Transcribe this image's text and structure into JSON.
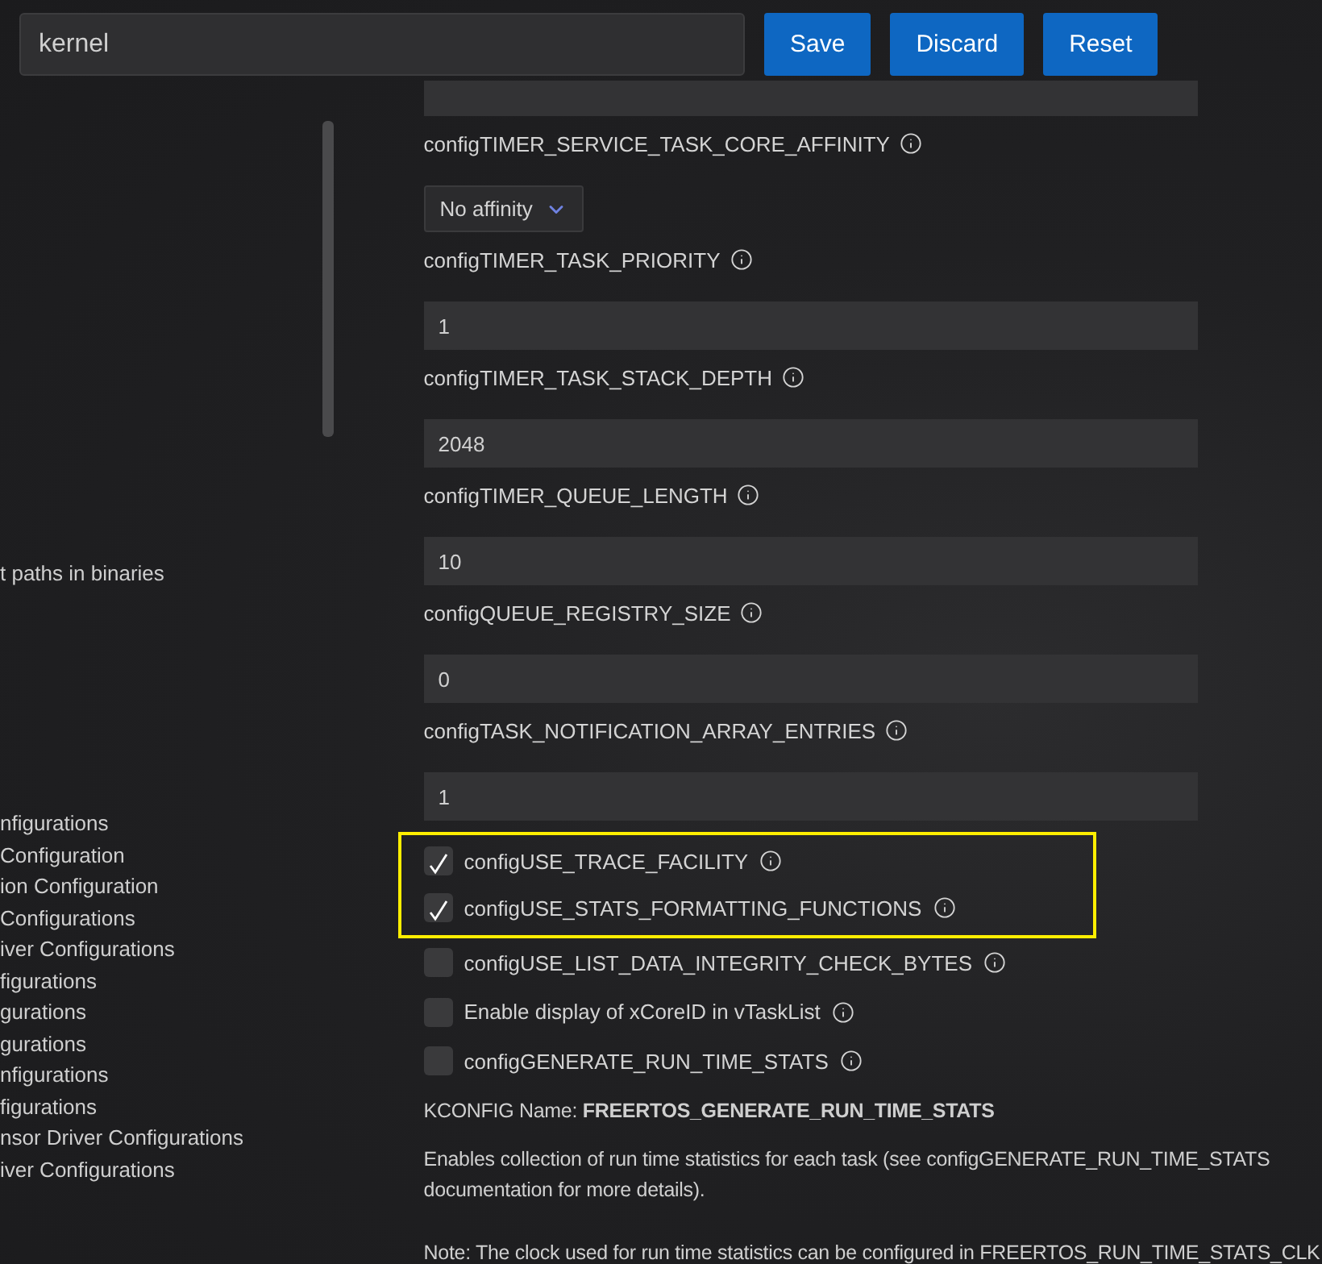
{
  "search": {
    "value": "kernel"
  },
  "buttons": [
    "Save",
    "Discard",
    "Reset"
  ],
  "sidebar": {
    "paths_item": "t paths in binaries",
    "items": [
      {
        "label": "nfigurations"
      },
      {
        "label": "Configuration"
      },
      {
        "label": "ion Configuration"
      },
      {
        "label": "Configurations"
      },
      {
        "label": "iver Configurations"
      },
      {
        "label": "figurations"
      },
      {
        "label": "gurations"
      },
      {
        "label": "gurations"
      },
      {
        "label": "nfigurations"
      },
      {
        "label": "figurations"
      },
      {
        "label": "nsor Driver Configurations"
      },
      {
        "label": "iver Configurations"
      }
    ]
  },
  "settings": [
    {
      "kind": "cut-field"
    },
    {
      "kind": "label",
      "label": "configTIMER_SERVICE_TASK_CORE_AFFINITY"
    },
    {
      "kind": "select",
      "value": "No affinity"
    },
    {
      "kind": "label",
      "label": "configTIMER_TASK_PRIORITY"
    },
    {
      "kind": "field",
      "value": "1"
    },
    {
      "kind": "label",
      "label": "configTIMER_TASK_STACK_DEPTH"
    },
    {
      "kind": "field",
      "value": "2048"
    },
    {
      "kind": "label",
      "label": "configTIMER_QUEUE_LENGTH"
    },
    {
      "kind": "field",
      "value": "10"
    },
    {
      "kind": "label",
      "label": "configQUEUE_REGISTRY_SIZE"
    },
    {
      "kind": "field",
      "value": "0"
    },
    {
      "kind": "label",
      "label": "configTASK_NOTIFICATION_ARRAY_ENTRIES"
    },
    {
      "kind": "field",
      "value": "1"
    },
    {
      "kind": "checkbox",
      "label": "configUSE_TRACE_FACILITY",
      "checked": true,
      "highlighted": true
    },
    {
      "kind": "checkbox",
      "label": "configUSE_STATS_FORMATTING_FUNCTIONS",
      "checked": true,
      "highlighted": true
    },
    {
      "kind": "checkbox",
      "label": "configUSE_LIST_DATA_INTEGRITY_CHECK_BYTES",
      "checked": false,
      "highlighted": false
    },
    {
      "kind": "checkbox",
      "label": "Enable display of xCoreID in vTaskList",
      "checked": false,
      "highlighted": false
    },
    {
      "kind": "checkbox",
      "label": "configGENERATE_RUN_TIME_STATS",
      "checked": false,
      "highlighted": false
    }
  ],
  "details": {
    "kconfig": "KCONFIG Name: **FREERTOS_GENERATE_RUN_TIME_STATS**",
    "description": "Enables collection of run time statistics for each task (see configGENERATE_RUN_TIME_STATS documentation for more details).",
    "note": "Note: The clock used for run time statistics can be configured in FREERTOS_RUN_TIME_STATS_CLK"
  }
}
